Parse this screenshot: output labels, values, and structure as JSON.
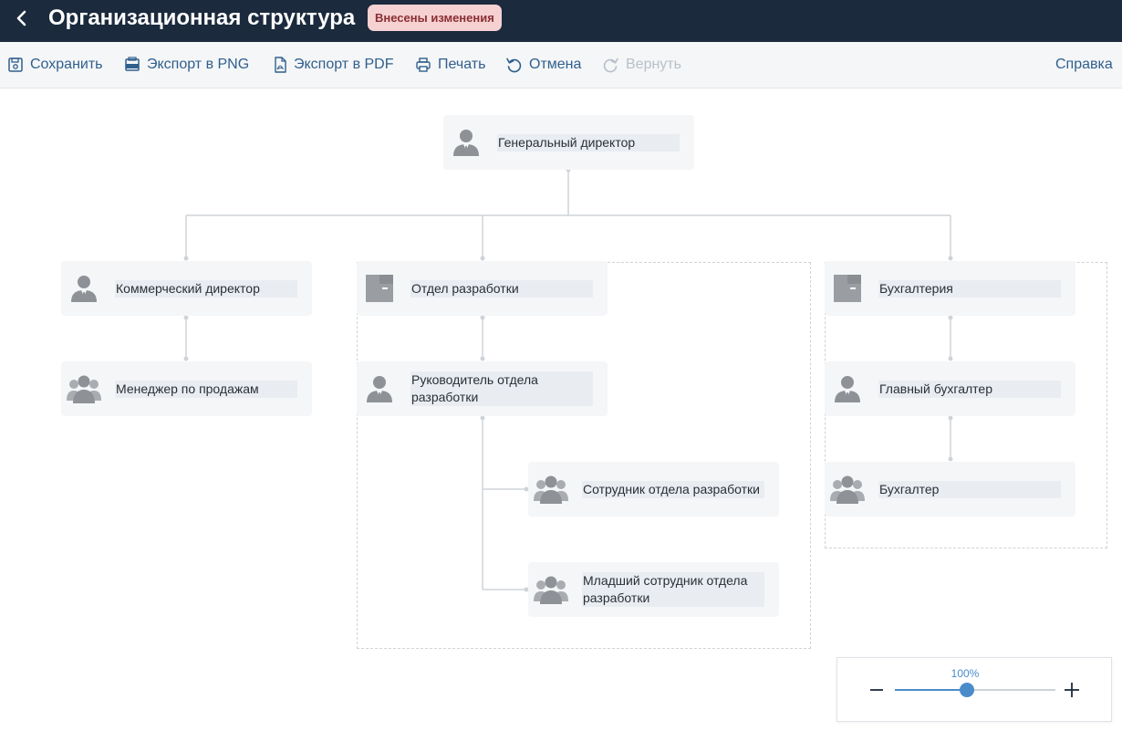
{
  "header": {
    "title": "Организационная структура",
    "badge": "Внесены изменения"
  },
  "toolbar": {
    "save": "Сохранить",
    "export_png": "Экспорт в PNG",
    "export_pdf": "Экспорт в PDF",
    "print": "Печать",
    "undo": "Отмена",
    "redo": "Вернуть",
    "help": "Справка"
  },
  "nodes": {
    "ceo": {
      "label": "Генеральный директор",
      "icon": "person-icon"
    },
    "commercial_director": {
      "label": "Коммерческий директор",
      "icon": "person-icon"
    },
    "sales_manager": {
      "label": "Менеджер по продажам",
      "icon": "group-icon"
    },
    "dev_department": {
      "label": "Отдел разработки",
      "icon": "department-icon"
    },
    "dev_head": {
      "label": "Руководитель отдела разработки",
      "icon": "person-icon"
    },
    "dev_employee": {
      "label": "Сотрудник отдела разработки",
      "icon": "group-icon"
    },
    "dev_junior": {
      "label": "Младший сотрудник отдела разработки",
      "icon": "group-icon"
    },
    "accounting": {
      "label": "Бухгалтерия",
      "icon": "department-icon"
    },
    "chief_accountant": {
      "label": "Главный бухгалтер",
      "icon": "person-icon"
    },
    "accountant": {
      "label": "Бухгалтер",
      "icon": "group-icon"
    }
  },
  "zoom": {
    "value": "100%",
    "level_fraction": 0.45
  },
  "colors": {
    "header_bg": "#1b2a3d",
    "badge_bg": "#f6d1d2",
    "link": "#2f5f8d",
    "accent": "#4a8cc9",
    "icon_gray": "#8e9297"
  }
}
